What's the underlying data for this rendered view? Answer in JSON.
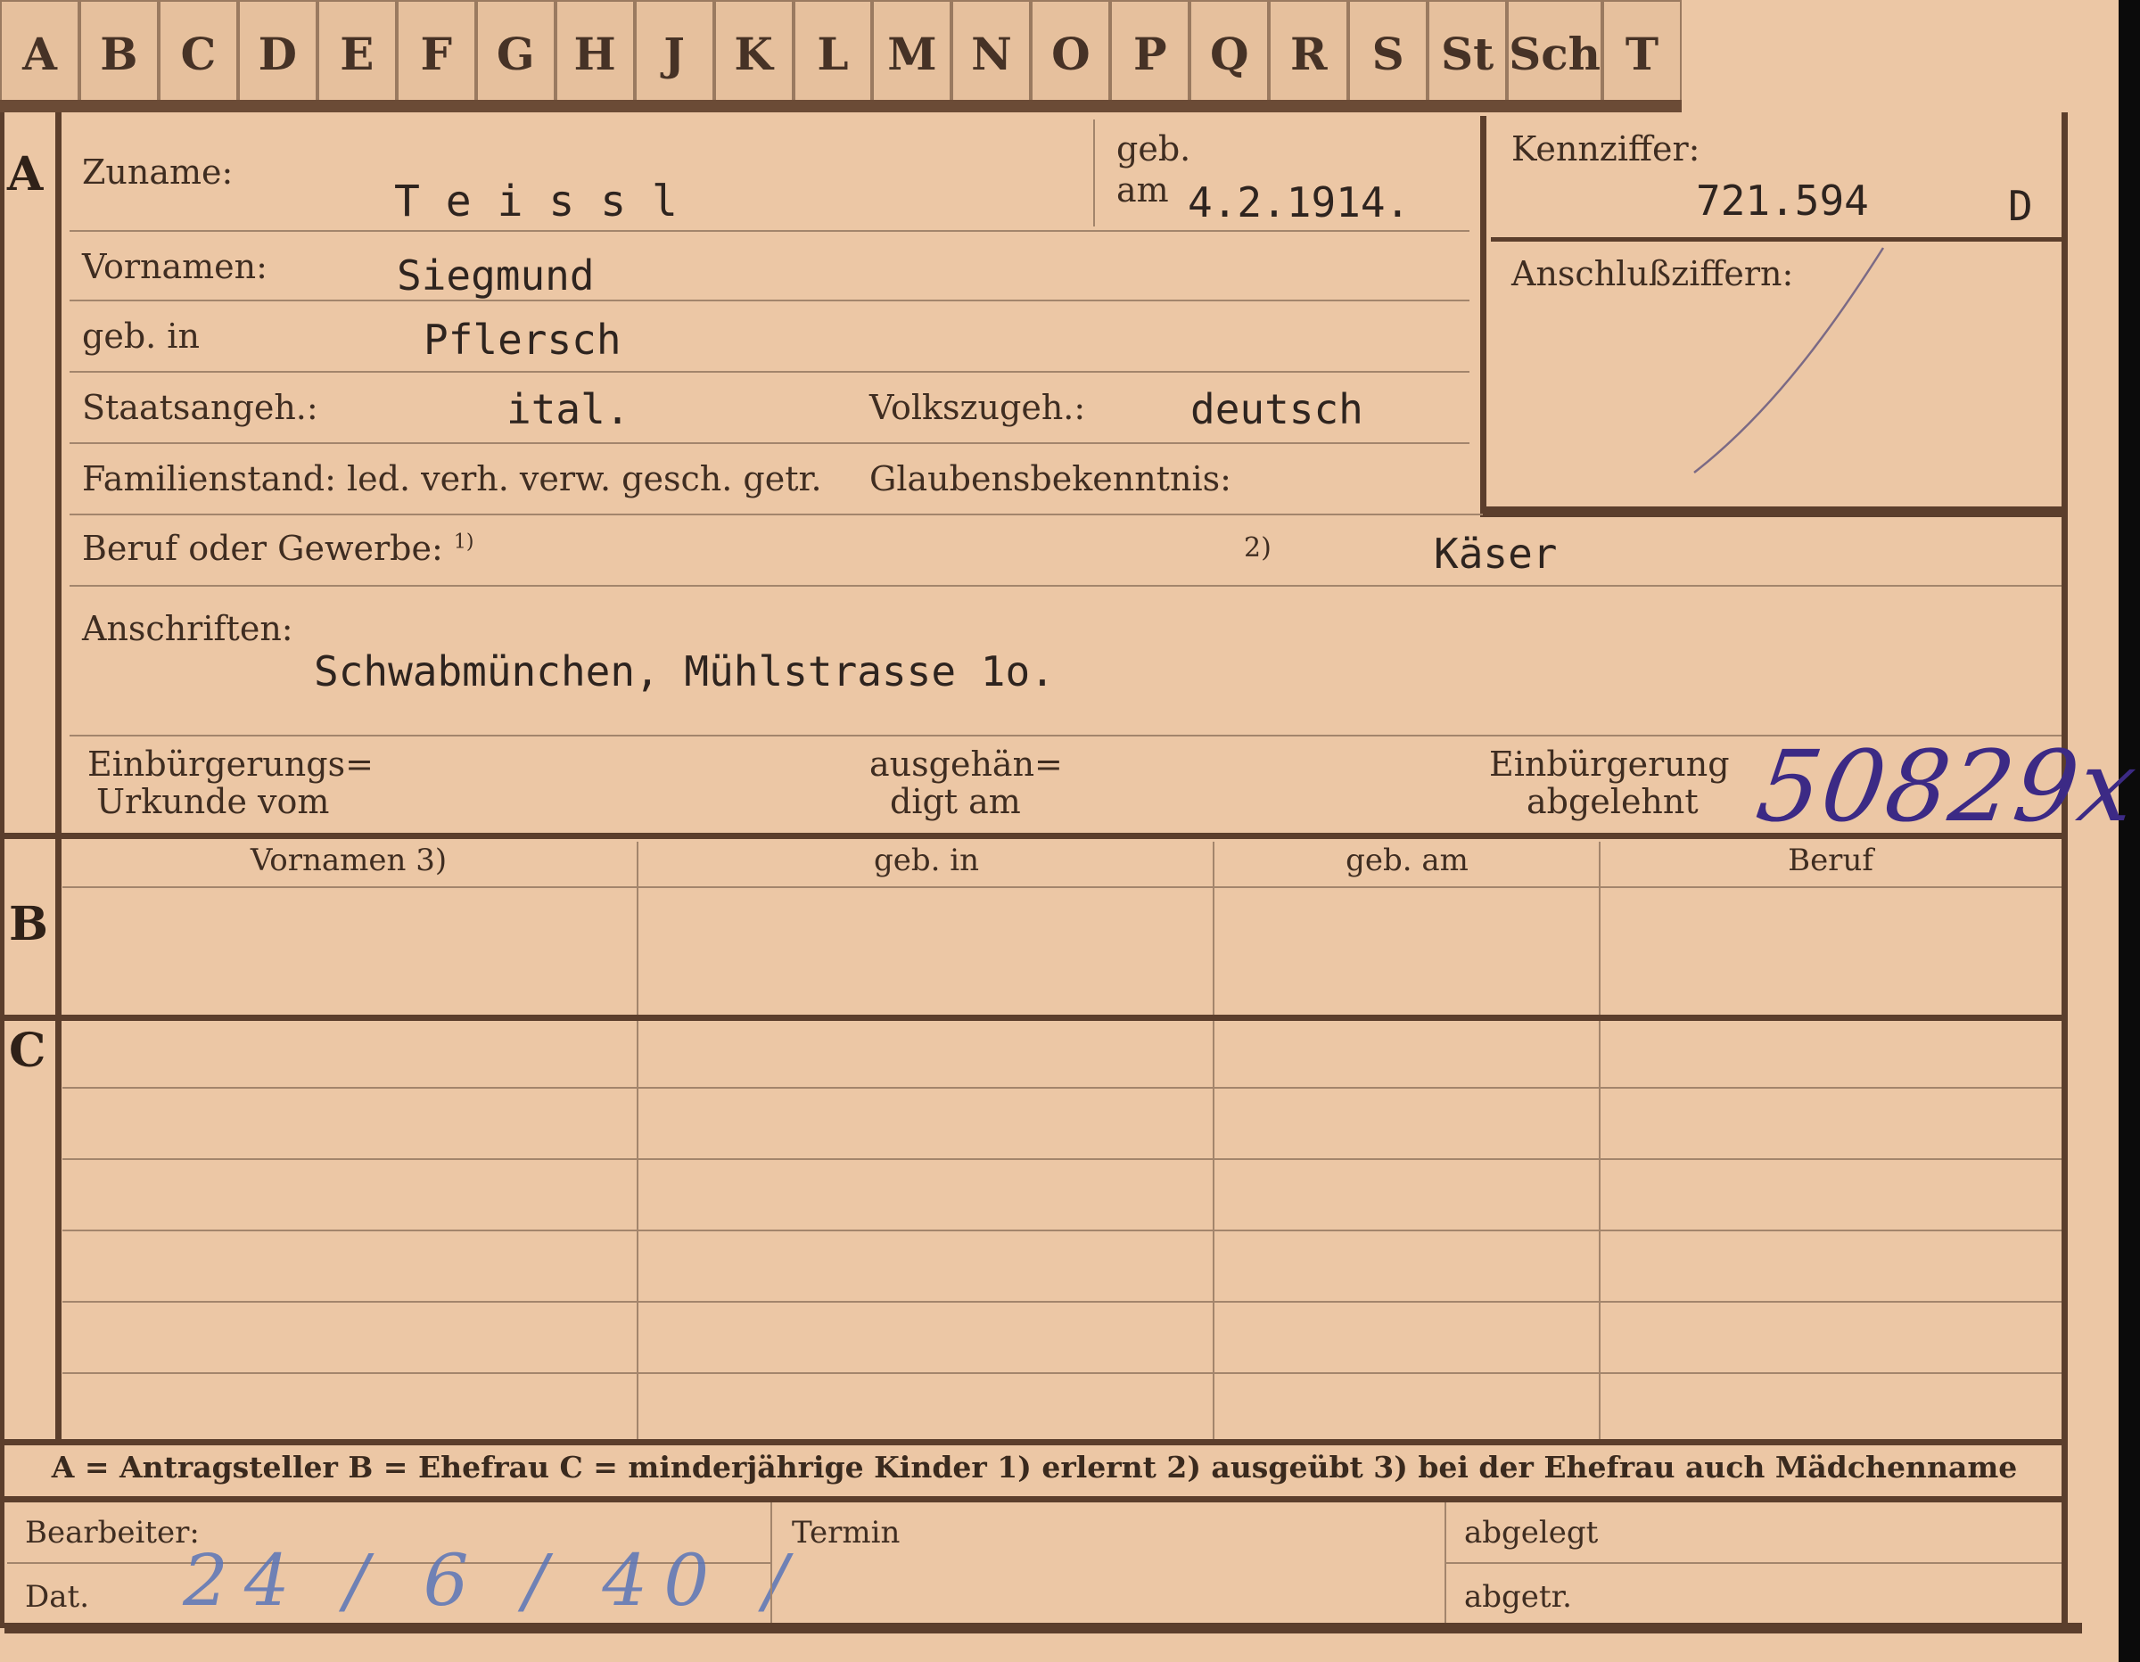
{
  "tabs": [
    "A",
    "B",
    "C",
    "D",
    "E",
    "F",
    "G",
    "H",
    "J",
    "K",
    "L",
    "M",
    "N",
    "O",
    "P",
    "Q",
    "R",
    "S",
    "St",
    "Sch",
    "T"
  ],
  "sections": {
    "a": "A",
    "b": "B",
    "c": "C"
  },
  "labels": {
    "zuname": "Zuname:",
    "geb": "geb.",
    "am": "am",
    "vornamen": "Vornamen:",
    "geb_in": "geb. in",
    "staatsangeh": "Staatsangeh.:",
    "volkszugeh": "Volkszugeh.:",
    "familienstand": "Familienstand: led. verh. verw. gesch. getr.",
    "glaubensbekenntnis": "Glaubensbekenntnis:",
    "beruf": "Beruf oder Gewerbe:",
    "fn1": "1)",
    "fn2": "2)",
    "anschriften": "Anschriften:",
    "einbuergerungs_line1": "Einbürgerungs=",
    "einbuergerungs_line2": "Urkunde vom",
    "ausgehaen_line1": "ausgehän=",
    "ausgehaen_line2": "digt am",
    "abgelehnt_line1": "Einbürgerung",
    "abgelehnt_line2": "abgelehnt",
    "kennziffer": "Kennziffer:",
    "anschlussziffern": "Anschlußziffern:"
  },
  "values": {
    "zuname": "T e i s s l",
    "geb_am": "4.2.1914.",
    "vornamen": "Siegmund",
    "geb_in": "Pflersch",
    "staatsangeh": "ital.",
    "volkszugeh": "deutsch",
    "beruf": "Käser",
    "anschrift": "Schwabmünchen, Mühlstrasse 1o.",
    "kennziffer": "721.594",
    "kennziffer_suffix": "D",
    "abgelehnt_number": "50829x"
  },
  "table_headers": {
    "vornamen": "Vornamen 3)",
    "geb_in": "geb. in",
    "geb_am": "geb. am",
    "beruf": "Beruf"
  },
  "legend": "A = Antragsteller   B = Ehefrau   C = minderjährige Kinder   1) erlernt   2) ausgeübt   3) bei der Ehefrau auch Mädchenname",
  "footer": {
    "bearbeiter": "Bearbeiter:",
    "dat": "Dat.",
    "date_handwritten": "24 / 6 / 40 /",
    "termin": "Termin",
    "abgelegt": "abgelegt",
    "abgetr": "abgetr."
  },
  "colors": {
    "card": "#ecc7a5",
    "ink_blue": "#4f5fa8",
    "ink_purple": "#3c2a85"
  }
}
